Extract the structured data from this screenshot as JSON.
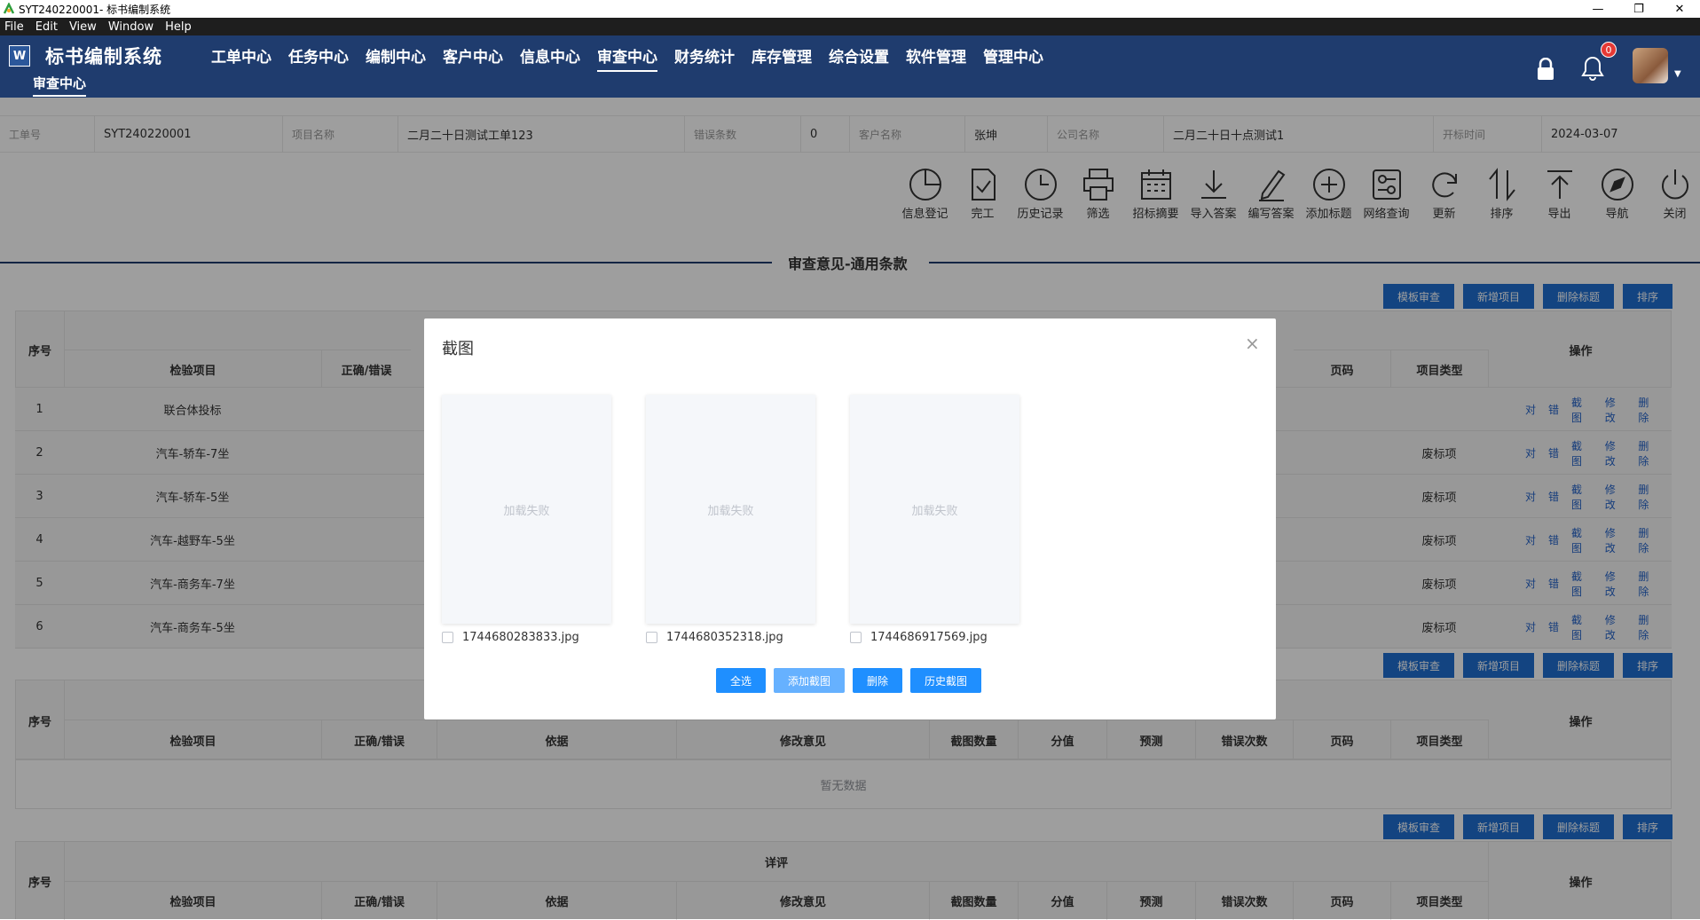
{
  "window": {
    "title": "SYT240220001- 标书编制系统",
    "controls": [
      "—",
      "❐",
      "✕"
    ]
  },
  "menu": [
    "File",
    "Edit",
    "View",
    "Window",
    "Help"
  ],
  "app": {
    "name": "标书编制系统",
    "logo_letter": "W",
    "notification_count": "0"
  },
  "nav": [
    "工单中心",
    "任务中心",
    "编制中心",
    "客户中心",
    "信息中心",
    "审查中心",
    "财务统计",
    "库存管理",
    "综合设置",
    "软件管理",
    "管理中心"
  ],
  "active_nav": "审查中心",
  "subnav": "审查中心",
  "info": [
    {
      "label": "工单号",
      "value": "SYT240220001"
    },
    {
      "label": "项目名称",
      "value": "二月二十日测试工单123"
    },
    {
      "label": "错误条数",
      "value": "0"
    },
    {
      "label": "客户名称",
      "value": "张坤"
    },
    {
      "label": "公司名称",
      "value": "二月二十日十点测试1"
    },
    {
      "label": "开标时间",
      "value": "2024-03-07"
    }
  ],
  "toolbar": [
    "信息登记",
    "完工",
    "历史记录",
    "筛选",
    "招标摘要",
    "导入答案",
    "编写答案",
    "添加标题",
    "网络查询",
    "更新",
    "排序",
    "导出",
    "导航",
    "关闭"
  ],
  "section_title": "审查意见-通用条款",
  "table_buttons": [
    "模板审查",
    "新增项目",
    "删除标题",
    "排序"
  ],
  "table_headers": {
    "seq": "序号",
    "item": "检验项目",
    "correct": "正确/错误",
    "basis": "依据",
    "opinion": "修改意见",
    "shots": "截图数量",
    "score": "分值",
    "forecast": "预测",
    "errors": "错误次数",
    "page": "页码",
    "type": "项目类型",
    "ops": "操作"
  },
  "table1_rows": [
    {
      "seq": "1",
      "item": "联合体投标",
      "type": ""
    },
    {
      "seq": "2",
      "item": "汽车-轿车-7坐",
      "type": "废标项"
    },
    {
      "seq": "3",
      "item": "汽车-轿车-5坐",
      "type": "废标项"
    },
    {
      "seq": "4",
      "item": "汽车-越野车-5坐",
      "type": "废标项"
    },
    {
      "seq": "5",
      "item": "汽车-商务车-7坐",
      "type": "废标项"
    },
    {
      "seq": "6",
      "item": "汽车-商务车-5坐",
      "type": "废标项"
    }
  ],
  "row_ops": [
    "对",
    "错",
    "截图",
    "修改",
    "删除"
  ],
  "empty_text": "暂无数据",
  "table3_group": "详评",
  "modal": {
    "title": "截图",
    "close": "×",
    "load_failed": "加载失败",
    "files": [
      "1744680283833.jpg",
      "1744680352318.jpg",
      "1744686917569.jpg"
    ],
    "buttons": [
      "全选",
      "添加截图",
      "删除",
      "历史截图"
    ]
  }
}
